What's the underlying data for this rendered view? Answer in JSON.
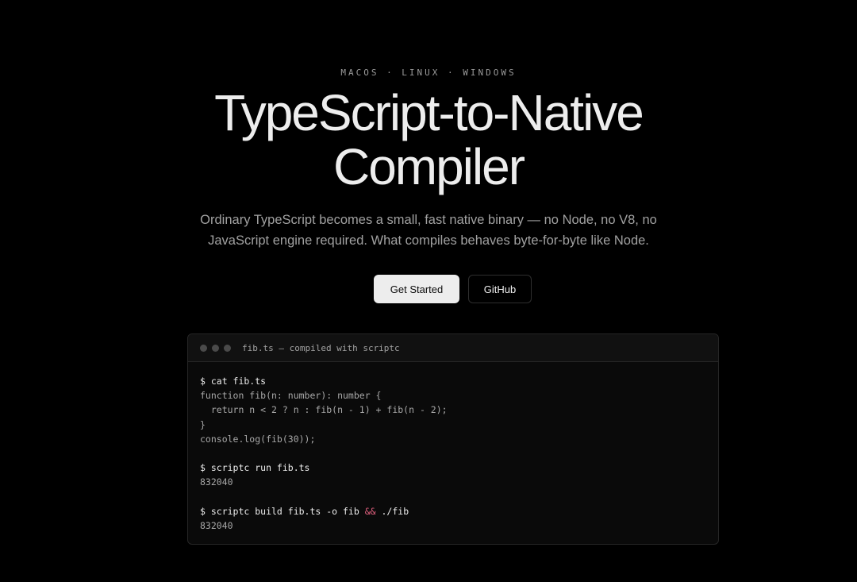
{
  "hero": {
    "platforms": "MACOS · LINUX · WINDOWS",
    "title_line1": "TypeScript-to-Native",
    "title_line2": "Compiler",
    "subtitle_line1": "Ordinary TypeScript becomes a small, fast native binary — no Node, no V8, no",
    "subtitle_line2": "JavaScript engine required. What compiles behaves byte-for-byte like Node."
  },
  "buttons": {
    "primary_label": "Get Started",
    "secondary_label": "GitHub"
  },
  "terminal": {
    "title": "fib.ts — compiled with scriptc",
    "window_dots": [
      "close-dot",
      "minimize-dot",
      "maximize-dot"
    ],
    "lines": {
      "l1": "$ cat fib.ts",
      "l2": "function fib(n: number): number {",
      "l3": "  return n < 2 ? n : fib(n - 1) + fib(n - 2);",
      "l4": "}",
      "l5": "console.log(fib(30));",
      "l6": "$ scriptc run fib.ts",
      "l7": "832040",
      "l8_before": "$ scriptc build fib.ts -o fib ",
      "l8_op": "&&",
      "l8_after": " ./fib",
      "l9": "832040"
    }
  },
  "colors": {
    "background": "#000000",
    "text": "#ededed",
    "muted": "#a1a1a1",
    "operator": "#e0607e"
  }
}
